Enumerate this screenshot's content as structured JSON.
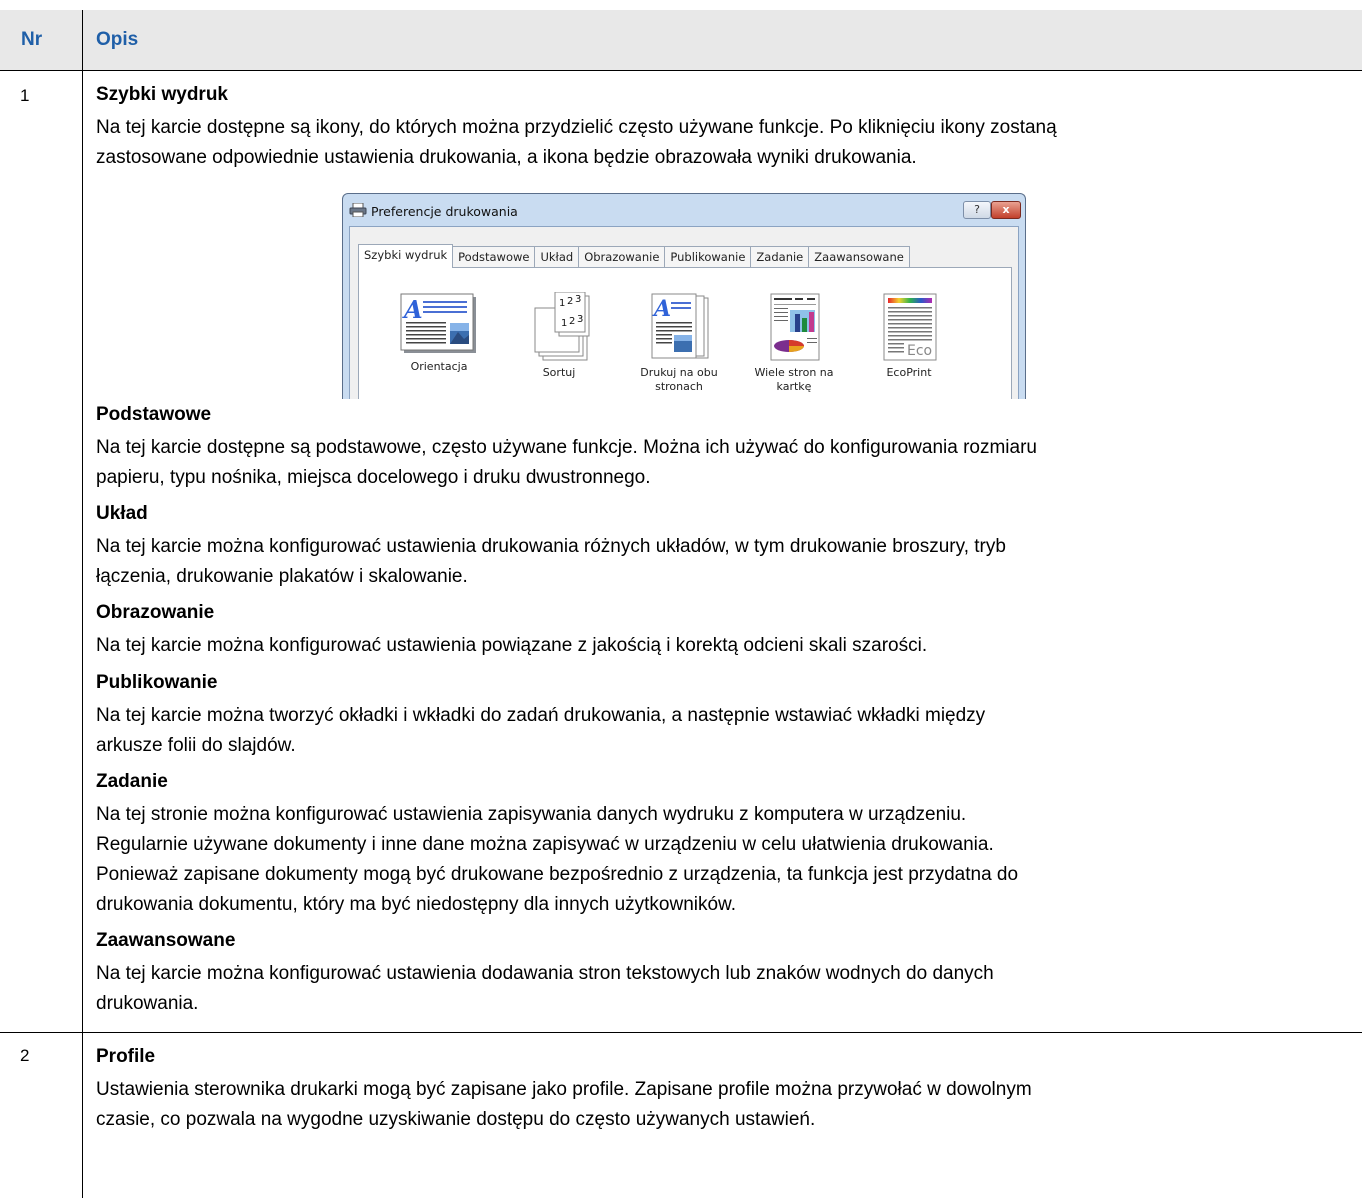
{
  "table": {
    "header_nr": "Nr",
    "header_opis": "Opis"
  },
  "row1": {
    "number": "1",
    "title": "Szybki wydruk",
    "text_line1": "Na tej karcie dostępne są ikony, do których można przydzielić często używane funkcje. Po kliknięciu ikony zostaną",
    "text_line2": "zastosowane odpowiednie ustawienia drukowania, a ikona będzie obrazowała wyniki drukowania.",
    "sections": [
      {
        "title": "Podstawowe",
        "lines": [
          "Na tej karcie dostępne są podstawowe, często używane funkcje. Można ich używać do konfigurowania rozmiaru",
          "papieru, typu nośnika, miejsca docelowego i druku dwustronnego."
        ]
      },
      {
        "title": "Układ",
        "lines": [
          "Na tej karcie można konfigurować ustawienia drukowania różnych układów, w tym drukowanie broszury, tryb",
          "łączenia, drukowanie plakatów i skalowanie."
        ]
      },
      {
        "title": "Obrazowanie",
        "lines": [
          "Na tej karcie można konfigurować ustawienia powiązane z jakością i korektą odcieni skali szarości."
        ]
      },
      {
        "title": "Publikowanie",
        "lines": [
          "Na tej karcie można tworzyć okładki i wkładki do zadań drukowania, a następnie wstawiać wkładki między",
          "arkusze folii do slajdów."
        ]
      },
      {
        "title": "Zadanie",
        "lines": [
          "Na tej stronie można konfigurować ustawienia zapisywania danych wydruku z komputera w urządzeniu.",
          "Regularnie używane dokumenty i inne dane można zapisywać w urządzeniu w celu ułatwienia drukowania.",
          "Ponieważ zapisane dokumenty mogą być drukowane bezpośrednio z urządzenia, ta funkcja jest przydatna do",
          "drukowania dokumentu, który ma być niedostępny dla innych użytkowników."
        ]
      },
      {
        "title": "Zaawansowane",
        "lines": [
          "Na tej karcie można konfigurować ustawienia dodawania stron tekstowych lub znaków wodnych do danych",
          "drukowania."
        ]
      }
    ]
  },
  "row2": {
    "number": "2",
    "title": "Profile",
    "lines": [
      "Ustawienia sterownika drukarki mogą być zapisane jako profile. Zapisane profile można przywołać w dowolnym",
      "czasie, co pozwala na wygodne uzyskiwanie dostępu do często używanych ustawień."
    ]
  },
  "dialog": {
    "title": "Preferencje drukowania",
    "help_label": "?",
    "close_label": "x",
    "tabs": [
      "Szybki wydruk",
      "Podstawowe",
      "Układ",
      "Obrazowanie",
      "Publikowanie",
      "Zadanie",
      "Zaawansowane"
    ],
    "quick_items": [
      {
        "label_1": "Orientacja",
        "label_2": "",
        "icon": "orientation-icon"
      },
      {
        "label_1": "Sortuj",
        "label_2": "",
        "icon": "collate-icon"
      },
      {
        "label_1": "Drukuj na obu",
        "label_2": "stronach",
        "icon": "duplex-icon"
      },
      {
        "label_1": "Wiele stron na",
        "label_2": "kartkę",
        "icon": "multi-page-icon"
      },
      {
        "label_1": "EcoPrint",
        "label_2": "",
        "icon": "ecoprint-icon"
      }
    ],
    "icon_texts": {
      "letter_a": "A",
      "collate_1": "1",
      "collate_2": "2",
      "collate_3": "3",
      "eco": "Eco"
    }
  }
}
